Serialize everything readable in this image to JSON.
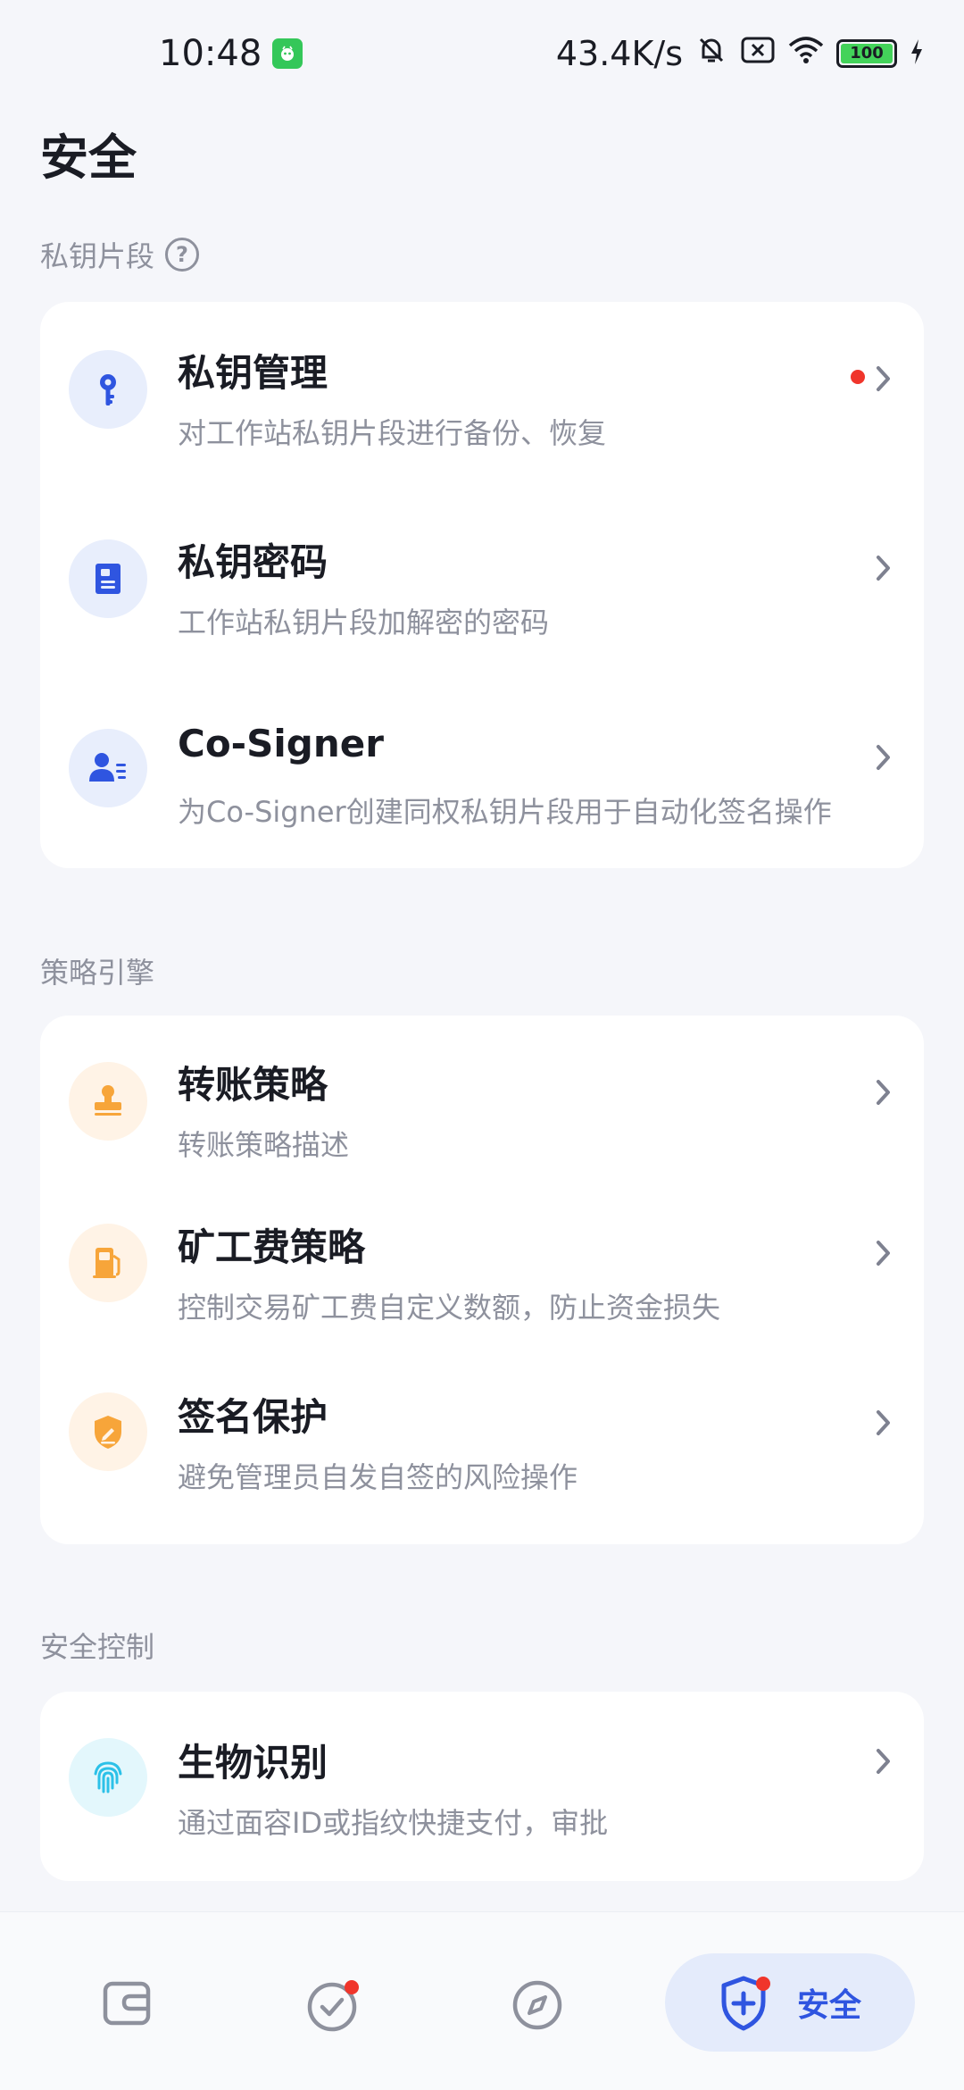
{
  "status_bar": {
    "time": "10:48",
    "network_speed": "43.4K/s",
    "battery_level": "100"
  },
  "page": {
    "title": "安全"
  },
  "sections": {
    "private_key": {
      "title": "私钥片段",
      "items": [
        {
          "title": "私钥管理",
          "desc": "对工作站私钥片段进行备份、恢复",
          "icon": "key-icon",
          "has_dot": true
        },
        {
          "title": "私钥密码",
          "desc": "工作站私钥片段加解密的密码",
          "icon": "password-book-icon",
          "has_dot": false
        },
        {
          "title": "Co-Signer",
          "desc": "为Co-Signer创建同权私钥片段用于自动化签名操作",
          "icon": "co-signer-user-icon",
          "has_dot": false
        }
      ]
    },
    "policy": {
      "title": "策略引擎",
      "items": [
        {
          "title": "转账策略",
          "desc": "转账策略描述",
          "icon": "stamp-icon"
        },
        {
          "title": "矿工费策略",
          "desc": "控制交易矿工费自定义数额，防止资金损失",
          "icon": "fuel-pump-icon"
        },
        {
          "title": "签名保护",
          "desc": "避免管理员自发自签的风险操作",
          "icon": "shield-pen-icon"
        }
      ]
    },
    "security_control": {
      "title": "安全控制",
      "items": [
        {
          "title": "生物识别",
          "desc": "通过面容ID或指纹快捷支付，审批",
          "icon": "fingerprint-icon"
        }
      ]
    }
  },
  "bottom_nav": {
    "active_label": "安全",
    "items": [
      "wallet-icon",
      "approval-check-icon",
      "compass-icon",
      "security-shield-icon"
    ]
  },
  "colors": {
    "accent": "#2F55E0",
    "blue_icon_bg": "#E8EEFC",
    "orange_icon": "#F7A53A",
    "orange_icon_bg": "#FFF3E6",
    "cyan_icon": "#2CC1E8",
    "cyan_icon_bg": "#E3F7FC",
    "badge_red": "#F0352B"
  }
}
